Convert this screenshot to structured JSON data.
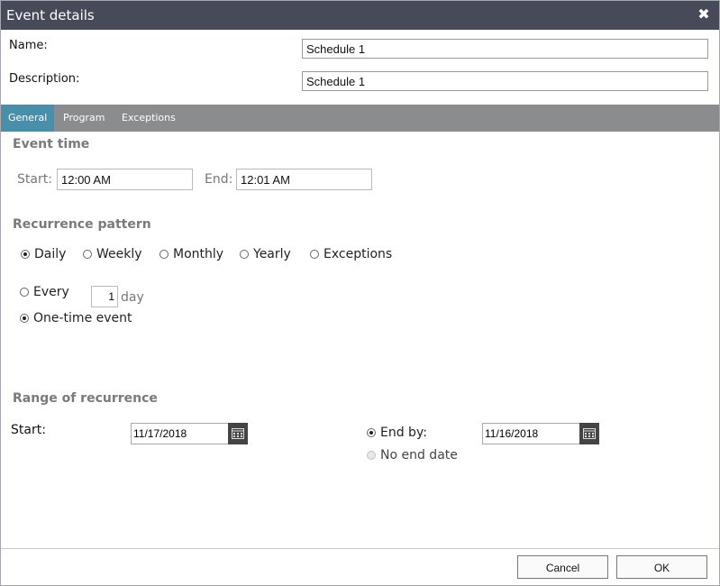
{
  "dialog": {
    "title": "Event details",
    "close_symbol": "✖"
  },
  "name": {
    "label": "Name:",
    "value": "Schedule 1"
  },
  "description": {
    "label": "Description:",
    "value": "Schedule 1"
  },
  "tabs": [
    {
      "label": "General",
      "active": true
    },
    {
      "label": "Program",
      "active": false
    },
    {
      "label": "Exceptions",
      "active": false
    }
  ],
  "event_time": {
    "title": "Event time",
    "start_label": "Start:",
    "start_value": "12:00 AM",
    "end_label": "End:",
    "end_value": "12:01 AM"
  },
  "recurrence": {
    "title": "Recurrence pattern",
    "options": [
      {
        "label": "Daily",
        "checked": true
      },
      {
        "label": "Weekly",
        "checked": false
      },
      {
        "label": "Monthly",
        "checked": false
      },
      {
        "label": "Yearly",
        "checked": false
      },
      {
        "label": "Exceptions",
        "checked": false
      }
    ],
    "every_label": "Every",
    "every_value": "1",
    "every_unit": "day",
    "every_checked": false,
    "onetime_label": "One-time event",
    "onetime_checked": true
  },
  "range": {
    "title": "Range of recurrence",
    "start_label": "Start:",
    "start_value": "11/17/2018",
    "end_by_label": "End by:",
    "end_by_checked": true,
    "end_by_value": "11/16/2018",
    "no_end_label": "No end date",
    "no_end_checked": false
  },
  "buttons": {
    "cancel": "Cancel",
    "ok": "OK"
  },
  "colors": {
    "titlebar": "#474a59",
    "tabbar": "#8b8c8e",
    "active_tab": "#4a8faa",
    "section_title": "#7a7a7a"
  }
}
